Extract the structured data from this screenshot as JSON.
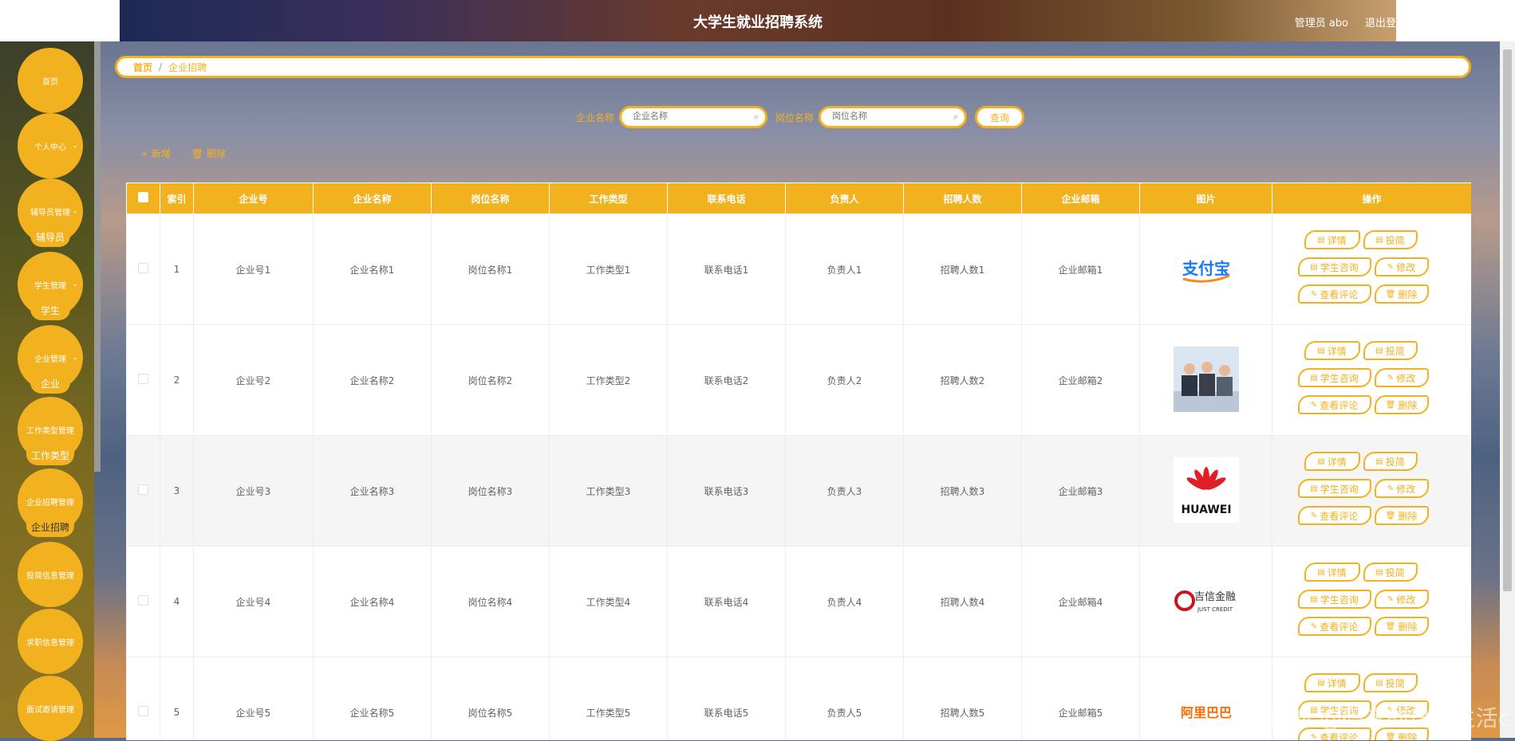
{
  "header": {
    "title": "大学生就业招聘系统",
    "admin": "管理员 abo",
    "logout": "退出登"
  },
  "sidebar": {
    "items": [
      {
        "label": "首页",
        "has_sub": false
      },
      {
        "label": "个人中心",
        "has_sub": true
      },
      {
        "label": "辅导员管理",
        "has_sub": true,
        "sub": "辅导员"
      },
      {
        "label": "学生管理",
        "has_sub": true,
        "sub": "学生"
      },
      {
        "label": "企业管理",
        "has_sub": true,
        "sub": "企业"
      },
      {
        "label": "工作类型管理",
        "has_sub": false,
        "sub": "工作类型"
      },
      {
        "label": "企业招聘管理",
        "has_sub": false,
        "sub": "企业招聘"
      },
      {
        "label": "投简信息管理",
        "has_sub": false
      },
      {
        "label": "求职信息管理",
        "has_sub": false
      },
      {
        "label": "面试邀请管理",
        "has_sub": false
      }
    ]
  },
  "breadcrumb": {
    "home": "首页",
    "separator": "/",
    "current": "企业招聘"
  },
  "search": {
    "company_label": "企业名称",
    "company_placeholder": "企业名称",
    "job_label": "岗位名称",
    "job_placeholder": "岗位名称",
    "query_label": "查询"
  },
  "toolbar": {
    "add_label": "+ 新增",
    "delete_label": "删除"
  },
  "table": {
    "headers": [
      "索引",
      "企业号",
      "企业名称",
      "岗位名称",
      "工作类型",
      "联系电话",
      "负责人",
      "招聘人数",
      "企业邮箱",
      "图片",
      "操作"
    ],
    "rows": [
      {
        "index": "1",
        "company_no": "企业号1",
        "company_name": "企业名称1",
        "job_name": "岗位名称1",
        "job_type": "工作类型1",
        "phone": "联系电话1",
        "owner": "负责人1",
        "hire_count": "招聘人数1",
        "email": "企业邮箱1",
        "logo_text": "支付宝"
      },
      {
        "index": "2",
        "company_no": "企业号2",
        "company_name": "企业名称2",
        "job_name": "岗位名称2",
        "job_type": "工作类型2",
        "phone": "联系电话2",
        "owner": "负责人2",
        "hire_count": "招聘人数2",
        "email": "企业邮箱2",
        "logo_text": ""
      },
      {
        "index": "3",
        "company_no": "企业号3",
        "company_name": "企业名称3",
        "job_name": "岗位名称3",
        "job_type": "工作类型3",
        "phone": "联系电话3",
        "owner": "负责人3",
        "hire_count": "招聘人数3",
        "email": "企业邮箱3",
        "logo_text": "HUAWEI"
      },
      {
        "index": "4",
        "company_no": "企业号4",
        "company_name": "企业名称4",
        "job_name": "岗位名称4",
        "job_type": "工作类型4",
        "phone": "联系电话4",
        "owner": "负责人4",
        "hire_count": "招聘人数4",
        "email": "企业邮箱4",
        "logo_text": "吉信金融",
        "logo_sub": "JUST CREDIT"
      },
      {
        "index": "5",
        "company_no": "企业号5",
        "company_name": "企业名称5",
        "job_name": "岗位名称5",
        "job_type": "工作类型5",
        "phone": "联系电话5",
        "owner": "负责人5",
        "hire_count": "招聘人数5",
        "email": "企业邮箱5",
        "logo_text": "阿里巴巴"
      }
    ],
    "ops": [
      "详情",
      "投简",
      "学生咨询",
      "修改",
      "查看评论",
      "删除"
    ]
  },
  "watermark": "CSDN @码农的日常生活c",
  "colors": {
    "accent": "#f2b11e",
    "text": "#606266"
  }
}
